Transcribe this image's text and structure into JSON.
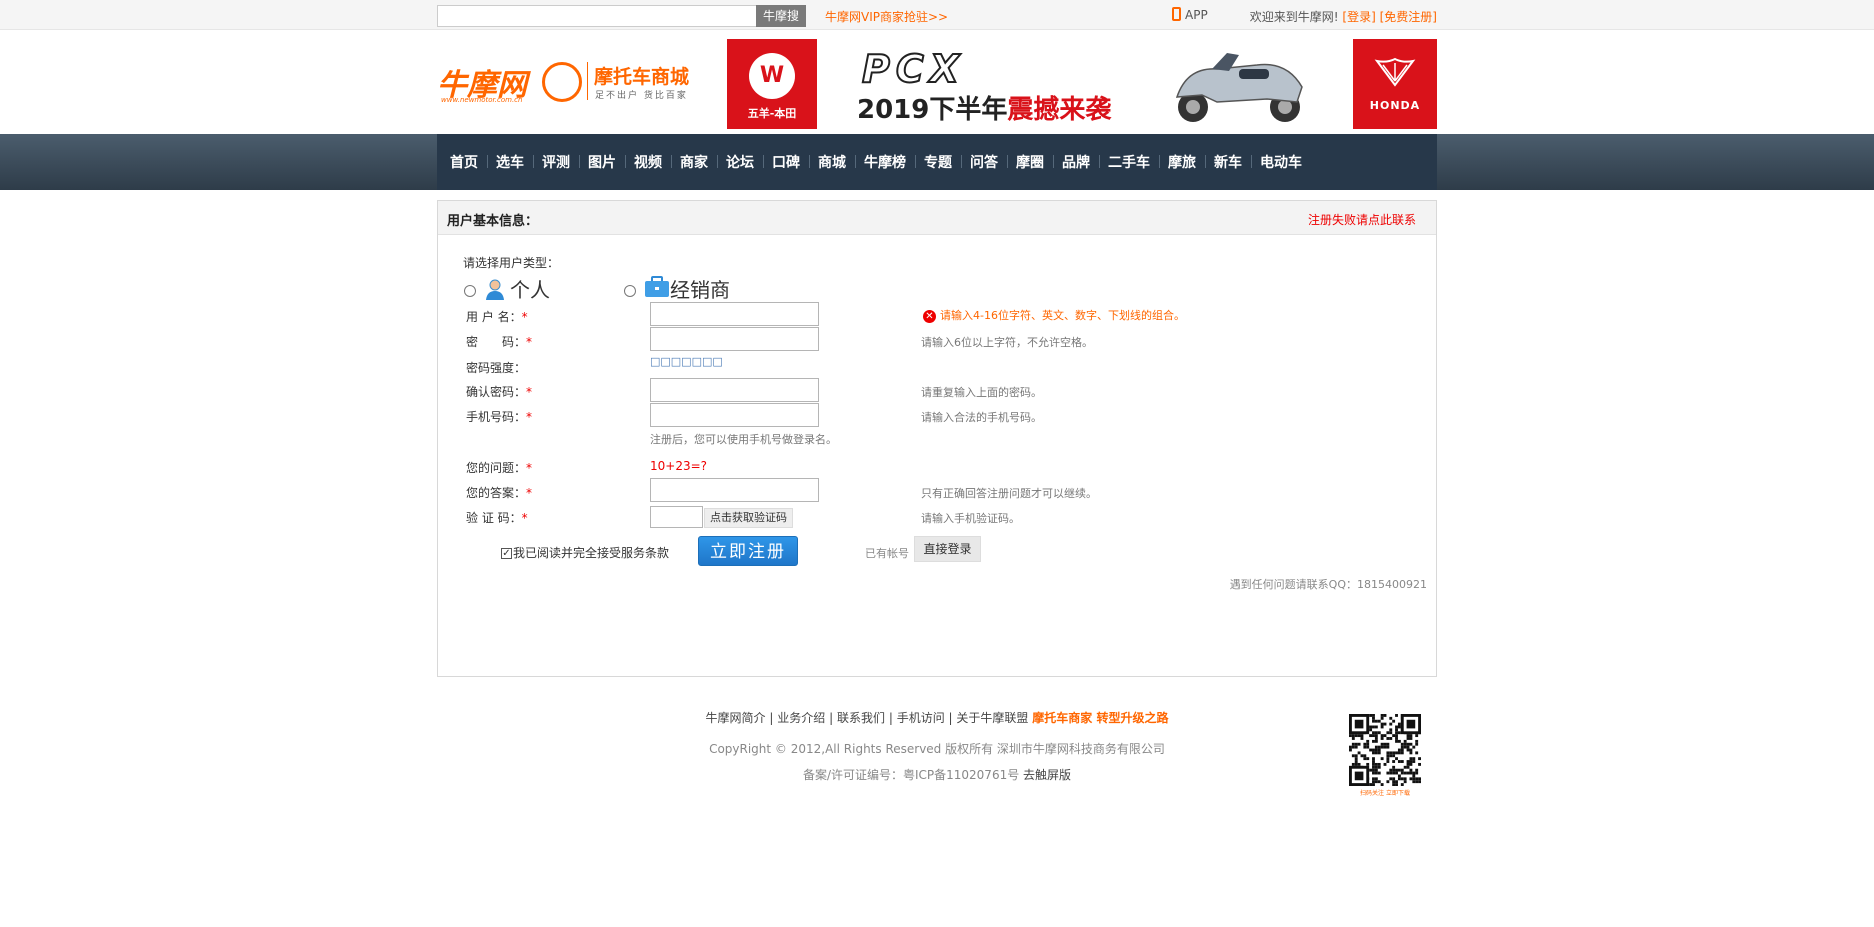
{
  "topbar": {
    "search_button": "牛摩搜",
    "vip_link": "牛摩网VIP商家抢驻>>",
    "app_label": "APP",
    "welcome": "欢迎来到牛摩网!",
    "login": "[登录]",
    "register": "[免费注册]"
  },
  "logo": {
    "name": "牛摩网",
    "url": "www.newmotor.com.cn",
    "mall": "摩托车商城",
    "slogan": "足不出户  货比百家"
  },
  "banner": {
    "brand_left": "五羊-本田",
    "brand_left_mark": "W",
    "model": "PCX",
    "slogan_prefix": "2019下半年",
    "slogan_hot": "震撼来袭",
    "brand_right": "HONDA"
  },
  "nav": {
    "items": [
      "首页",
      "选车",
      "评测",
      "图片",
      "视频",
      "商家",
      "论坛",
      "口碑",
      "商城",
      "牛摩榜",
      "专题",
      "问答",
      "摩圈",
      "品牌",
      "二手车",
      "摩旅",
      "新车",
      "电动车"
    ]
  },
  "panel": {
    "title": "用户基本信息：",
    "fail_contact": "注册失败请点此联系",
    "user_type_title": "请选择用户类型：",
    "type_personal": "个人",
    "type_dealer": "经销商",
    "fields": {
      "username": {
        "label": "用 户 名：",
        "required": "*",
        "error": "请输入4-16位字符、英文、数字、下划线的组合。"
      },
      "password": {
        "label": "密　　码：",
        "required": "*",
        "hint": "请输入6位以上字符，不允许空格。"
      },
      "strength": {
        "label": "密码强度：",
        "value": "□□□□□□□"
      },
      "confirm": {
        "label": "确认密码：",
        "required": "*",
        "hint": "请重复输入上面的密码。"
      },
      "phone": {
        "label": "手机号码：",
        "required": "*",
        "hint": "请输入合法的手机号码。",
        "note": "注册后，您可以使用手机号做登录名。"
      },
      "question": {
        "label": "您的问题：",
        "required": "*",
        "value": "10+23=?"
      },
      "answer": {
        "label": "您的答案：",
        "required": "*",
        "hint": "只有正确回答注册问题才可以继续。"
      },
      "captcha": {
        "label": "验 证 码：",
        "required": "*",
        "button": "点击获取验证码",
        "hint": "请输入手机验证码。"
      }
    },
    "agree": "我已阅读并完全接受服务条款",
    "agree_checked": true,
    "register_button": "立即注册",
    "have_account": "已有帐号",
    "login_button": "直接登录",
    "contact_qq": "遇到任何问题请联系QQ：1815400921"
  },
  "footer": {
    "links": [
      "牛摩网简介",
      "业务介绍",
      "联系我们",
      "手机访问",
      "关于牛摩联盟"
    ],
    "separator": "|",
    "hot_link": "摩托车商家 转型升级之路",
    "copyright": "CopyRight © 2012,All Rights Reserved 版权所有 深圳市牛摩网科技商务有限公司",
    "icp": "备案/许可证编号：粤ICP备11020761号",
    "touch": "去触屏版",
    "qr_caption": "扫码关注  立即下载"
  },
  "colors": {
    "accent": "#ff6600",
    "nav_bg": "#27384a",
    "error": "#e00000",
    "register_button": "#2686d8"
  }
}
